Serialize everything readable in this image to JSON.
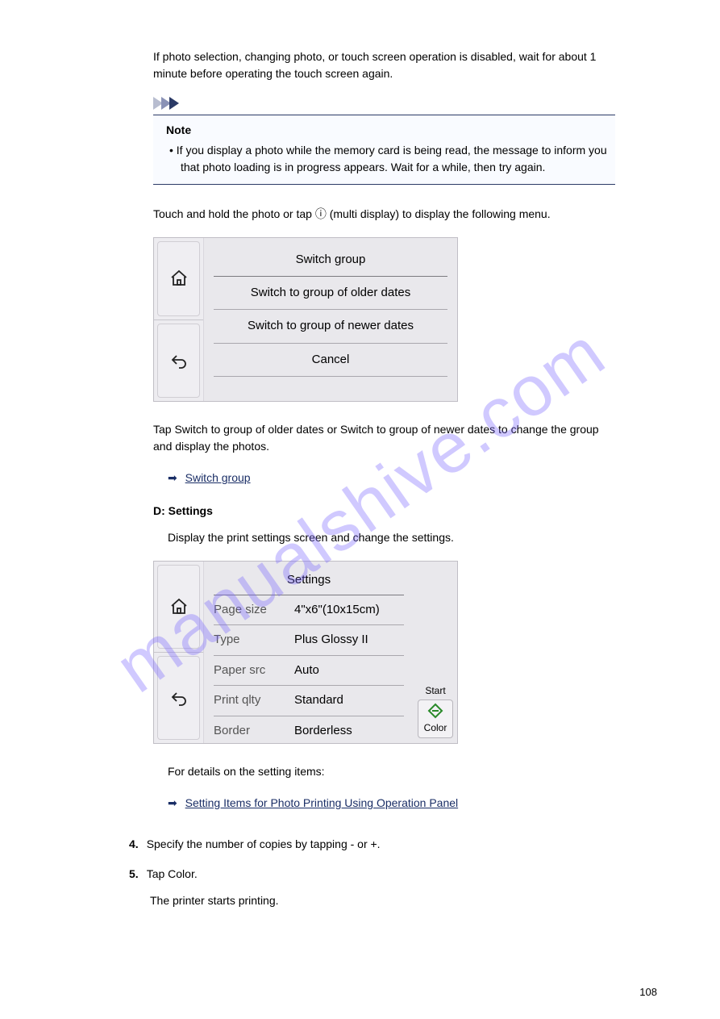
{
  "watermark": "manualshive.com",
  "intro1": "If photo selection, changing photo, or touch screen operation is disabled, wait for about 1 minute before operating the touch screen again.",
  "note": {
    "title": "Note",
    "body_bullet": "• ",
    "body": "If you display a photo while the memory card is being read, the message to inform you that photo loading is in progress appears. Wait for a while, then try again."
  },
  "intro2": "Touch and hold the photo or tap ⓘ (multi display) to display the following menu.",
  "screen1": {
    "title": "Switch group",
    "items": [
      "Switch to group of older dates",
      "Switch to group of newer dates",
      "Cancel"
    ]
  },
  "group_text": "Tap Switch to group of older dates or Switch to group of newer dates to change the group and display the photos.",
  "link1": "Switch group",
  "label_d_prefix": "D: ",
  "label_d_strong": "Settings",
  "settings_intro": "Display the print settings screen and change the settings.",
  "screen2": {
    "title": "Settings",
    "rows": [
      {
        "key": "Page size",
        "val": "4\"x6\"(10x15cm)"
      },
      {
        "key": "Type",
        "val": "Plus Glossy II"
      },
      {
        "key": "Paper src",
        "val": "Auto"
      },
      {
        "key": "Print qlty",
        "val": "Standard"
      },
      {
        "key": "Border",
        "val": "Borderless"
      }
    ],
    "start_label": "Start",
    "color_label": "Color"
  },
  "details_text": "For details on the setting items:",
  "link2": "Setting Items for Photo Printing Using Operation Panel",
  "para_last1": "4.",
  "para_last1_text": "Specify the number of copies by tapping - or +.",
  "para_last2": "5.",
  "para_last2_text": "Tap Color.",
  "para_last3": "The printer starts printing.",
  "page_num": "108"
}
